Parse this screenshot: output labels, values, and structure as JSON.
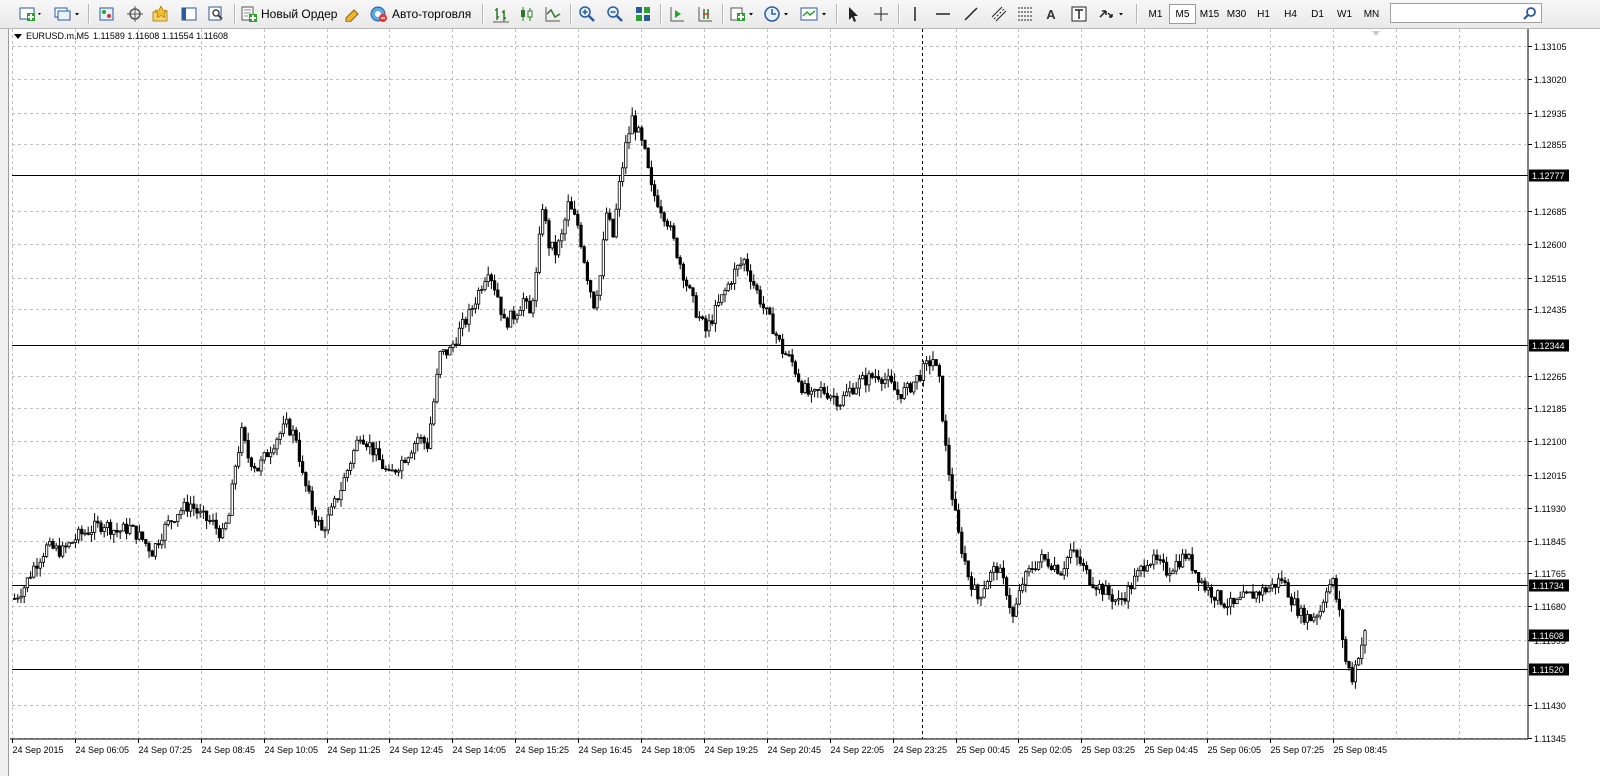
{
  "toolbar": {
    "new_order_label": "Новый Ордер",
    "auto_trading_label": "Авто-торговля",
    "timeframes": [
      {
        "label": "M1",
        "active": false
      },
      {
        "label": "M5",
        "active": true
      },
      {
        "label": "M15",
        "active": false
      },
      {
        "label": "M30",
        "active": false
      },
      {
        "label": "H1",
        "active": false
      },
      {
        "label": "H4",
        "active": false
      },
      {
        "label": "D1",
        "active": false
      },
      {
        "label": "W1",
        "active": false
      },
      {
        "label": "MN",
        "active": false
      }
    ],
    "search_value": ""
  },
  "chart_header": {
    "symbol": "EURUSD.m,M5",
    "ohlc": "1.11589 1.11608 1.11554 1.11608"
  },
  "chart_data": {
    "type": "candlestick",
    "symbol": "EURUSD.m",
    "timeframe": "M5",
    "y_ticks": [
      "1.13105",
      "1.13020",
      "1.12935",
      "1.12855",
      "1.12685",
      "1.12600",
      "1.12515",
      "1.12435",
      "1.12265",
      "1.12185",
      "1.12100",
      "1.12015",
      "1.11930",
      "1.11845",
      "1.11765",
      "1.11680",
      "1.11595",
      "1.11430",
      "1.11345"
    ],
    "y_range": [
      1.11345,
      1.1315
    ],
    "x_ticks": [
      "24 Sep 2015",
      "24 Sep 06:05",
      "24 Sep 07:25",
      "24 Sep 08:45",
      "24 Sep 10:05",
      "24 Sep 11:25",
      "24 Sep 12:45",
      "24 Sep 14:05",
      "24 Sep 15:25",
      "24 Sep 16:45",
      "24 Sep 18:05",
      "24 Sep 19:25",
      "24 Sep 20:45",
      "24 Sep 22:05",
      "24 Sep 23:25",
      "25 Sep 00:45",
      "25 Sep 02:05",
      "25 Sep 03:25",
      "25 Sep 04:45",
      "25 Sep 06:05",
      "25 Sep 07:25",
      "25 Sep 08:45"
    ],
    "horizontal_lines": [
      {
        "price": 1.12777,
        "label": "1.12777"
      },
      {
        "price": 1.12344,
        "label": "1.12344"
      },
      {
        "price": 1.11734,
        "label": "1.11734"
      },
      {
        "price": 1.1152,
        "label": "1.11520"
      }
    ],
    "current_price": {
      "price": 1.11608,
      "label": "1.11608"
    },
    "crosshair_vertical": "24 Sep 23:25",
    "grid": true,
    "price_path": [
      [
        0,
        1.117
      ],
      [
        3,
        1.1173
      ],
      [
        6,
        1.1178
      ],
      [
        10,
        1.1183
      ],
      [
        15,
        1.1182
      ],
      [
        20,
        1.1186
      ],
      [
        25,
        1.1188
      ],
      [
        28,
        1.1189
      ],
      [
        32,
        1.1187
      ],
      [
        36,
        1.1188
      ],
      [
        40,
        1.1185
      ],
      [
        43,
        1.1182
      ],
      [
        47,
        1.1188
      ],
      [
        51,
        1.1192
      ],
      [
        55,
        1.1194
      ],
      [
        58,
        1.1191
      ],
      [
        62,
        1.1189
      ],
      [
        65,
        1.1186
      ],
      [
        67,
        1.1191
      ],
      [
        69,
        1.1204
      ],
      [
        71,
        1.1212
      ],
      [
        73,
        1.1206
      ],
      [
        76,
        1.1203
      ],
      [
        79,
        1.1207
      ],
      [
        82,
        1.1211
      ],
      [
        85,
        1.1214
      ],
      [
        88,
        1.1211
      ],
      [
        90,
        1.1201
      ],
      [
        93,
        1.1193
      ],
      [
        96,
        1.1187
      ],
      [
        99,
        1.1192
      ],
      [
        102,
        1.1198
      ],
      [
        105,
        1.1205
      ],
      [
        108,
        1.1212
      ],
      [
        111,
        1.1209
      ],
      [
        114,
        1.1205
      ],
      [
        117,
        1.1201
      ],
      [
        120,
        1.1204
      ],
      [
        123,
        1.1207
      ],
      [
        126,
        1.1211
      ],
      [
        129,
        1.1209
      ],
      [
        131,
        1.122
      ],
      [
        133,
        1.1232
      ],
      [
        136,
        1.1233
      ],
      [
        139,
        1.1238
      ],
      [
        142,
        1.1242
      ],
      [
        145,
        1.1248
      ],
      [
        148,
        1.1254
      ],
      [
        151,
        1.1247
      ],
      [
        153,
        1.124
      ],
      [
        156,
        1.1242
      ],
      [
        159,
        1.1246
      ],
      [
        161,
        1.1242
      ],
      [
        163,
        1.1252
      ],
      [
        165,
        1.127
      ],
      [
        167,
        1.126
      ],
      [
        169,
        1.1258
      ],
      [
        171,
        1.1262
      ],
      [
        173,
        1.127
      ],
      [
        176,
        1.1265
      ],
      [
        179,
        1.1252
      ],
      [
        181,
        1.1245
      ],
      [
        183,
        1.1252
      ],
      [
        185,
        1.1268
      ],
      [
        187,
        1.1262
      ],
      [
        189,
        1.1275
      ],
      [
        191,
        1.1285
      ],
      [
        193,
        1.1292
      ],
      [
        195,
        1.1288
      ],
      [
        197,
        1.1283
      ],
      [
        199,
        1.1274
      ],
      [
        201,
        1.1271
      ],
      [
        204,
        1.1266
      ],
      [
        207,
        1.1258
      ],
      [
        210,
        1.125
      ],
      [
        213,
        1.1243
      ],
      [
        216,
        1.1238
      ],
      [
        219,
        1.1243
      ],
      [
        222,
        1.1248
      ],
      [
        225,
        1.1253
      ],
      [
        228,
        1.1256
      ],
      [
        231,
        1.125
      ],
      [
        234,
        1.1244
      ],
      [
        237,
        1.1239
      ],
      [
        240,
        1.1233
      ],
      [
        243,
        1.123
      ],
      [
        246,
        1.1224
      ],
      [
        249,
        1.1221
      ],
      [
        252,
        1.1223
      ],
      [
        255,
        1.1222
      ],
      [
        258,
        1.122
      ],
      [
        261,
        1.1223
      ],
      [
        264,
        1.1225
      ],
      [
        267,
        1.1226
      ],
      [
        270,
        1.1227
      ],
      [
        273,
        1.1225
      ],
      [
        276,
        1.1222
      ],
      [
        279,
        1.1223
      ],
      [
        282,
        1.1226
      ],
      [
        285,
        1.1229
      ],
      [
        287,
        1.1231
      ],
      [
        289,
        1.1225
      ],
      [
        291,
        1.1208
      ],
      [
        293,
        1.1196
      ],
      [
        295,
        1.1186
      ],
      [
        298,
        1.1176
      ],
      [
        301,
        1.117
      ],
      [
        304,
        1.1175
      ],
      [
        307,
        1.1178
      ],
      [
        310,
        1.1172
      ],
      [
        312,
        1.1165
      ],
      [
        315,
        1.1174
      ],
      [
        318,
        1.1178
      ],
      [
        321,
        1.118
      ],
      [
        324,
        1.1179
      ],
      [
        327,
        1.1177
      ],
      [
        330,
        1.1182
      ],
      [
        333,
        1.1179
      ],
      [
        336,
        1.1175
      ],
      [
        339,
        1.1173
      ],
      [
        342,
        1.1171
      ],
      [
        345,
        1.1169
      ],
      [
        348,
        1.1172
      ],
      [
        351,
        1.1176
      ],
      [
        354,
        1.118
      ],
      [
        357,
        1.1179
      ],
      [
        360,
        1.1177
      ],
      [
        363,
        1.1179
      ],
      [
        366,
        1.1181
      ],
      [
        369,
        1.1177
      ],
      [
        372,
        1.1173
      ],
      [
        375,
        1.1171
      ],
      [
        378,
        1.1169
      ],
      [
        381,
        1.1168
      ],
      [
        384,
        1.117
      ],
      [
        387,
        1.1171
      ],
      [
        390,
        1.1172
      ],
      [
        393,
        1.1173
      ],
      [
        396,
        1.1175
      ],
      [
        399,
        1.117
      ],
      [
        402,
        1.1166
      ],
      [
        405,
        1.1165
      ],
      [
        408,
        1.1167
      ],
      [
        410,
        1.1173
      ],
      [
        412,
        1.1174
      ],
      [
        414,
        1.1166
      ],
      [
        416,
        1.1154
      ],
      [
        418,
        1.115
      ],
      [
        420,
        1.1156
      ],
      [
        422,
        1.11608
      ]
    ]
  }
}
